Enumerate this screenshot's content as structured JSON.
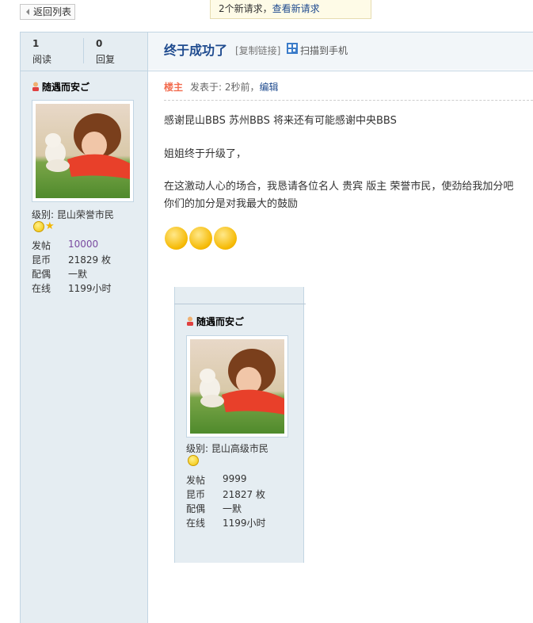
{
  "nav": {
    "back_label": "返回列表"
  },
  "notice": {
    "prefix": "2个新请求，",
    "link": "查看新请求"
  },
  "stats": {
    "views_num": "1",
    "views_label": "阅读",
    "replies_num": "0",
    "replies_label": "回复"
  },
  "thread": {
    "title": "终于成功了",
    "copy_link": "[复制链接]",
    "qr_label": "扫描到手机"
  },
  "post": {
    "floor_label": "楼主",
    "posted_prefix": "发表于: 2秒前，",
    "edit_label": "编辑",
    "lines": [
      "感谢昆山BBS  苏州BBS 将来还有可能感谢中央BBS",
      "姐姐终于升级了，",
      "在这激动人心的场合，我恳请各位名人 贵宾 版主 荣誉市民，使劲给我加分吧",
      "你们的加分是对我最大的鼓励"
    ],
    "emoji_icon": "laughing-face-icon"
  },
  "user": {
    "name": "随遇而安ご",
    "level": "级别: 昆山荣誉市民",
    "posts_label": "发帖",
    "posts_value": "10000",
    "coins_label": "昆币",
    "coins_value": "21829 枚",
    "spouse_label": "配偶",
    "spouse_value": "一默",
    "online_label": "在线",
    "online_value": "1199小时"
  },
  "embedded_user": {
    "name": "随遇而安ご",
    "level": "级别: 昆山高级市民",
    "posts_label": "发帖",
    "posts_value": "9999",
    "coins_label": "昆币",
    "coins_value": "21827 枚",
    "spouse_label": "配偶",
    "spouse_value": "一默",
    "online_label": "在线",
    "online_value": "1199小时"
  },
  "colors": {
    "link": "#1f4b8f",
    "sidebar_bg": "#e5edf2",
    "border": "#c2d5e3",
    "floor_label": "#f26c4f"
  }
}
